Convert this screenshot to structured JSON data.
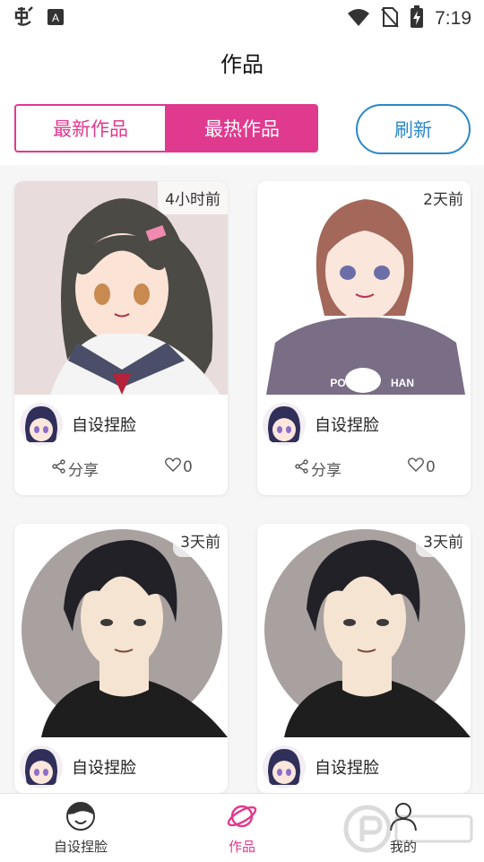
{
  "status_bar": {
    "time": "7:19",
    "left_icons": [
      "bug-app-icon",
      "a-notification-icon"
    ],
    "right_icons": [
      "wifi-icon",
      "no-sim-icon",
      "battery-charging-icon"
    ]
  },
  "header": {
    "title": "作品"
  },
  "tabs": {
    "latest": "最新作品",
    "hot": "最热作品",
    "active": "最热作品"
  },
  "refresh_label": "刷新",
  "cards": [
    {
      "time_ago": "4小时前",
      "author": "自设捏脸",
      "share_label": "分享",
      "likes": "0"
    },
    {
      "time_ago": "2天前",
      "author": "自设捏脸",
      "share_label": "分享",
      "likes": "0",
      "shirt_text_left": "PO",
      "shirt_text_right": "HAN"
    },
    {
      "time_ago": "3天前",
      "author": "自设捏脸"
    },
    {
      "time_ago": "3天前",
      "author": "自设捏脸"
    }
  ],
  "bottom_nav": [
    {
      "label": "自设捏脸",
      "icon": "face-icon",
      "active": false
    },
    {
      "label": "作品",
      "icon": "planet-icon",
      "active": true
    },
    {
      "label": "我的",
      "icon": "person-icon",
      "active": false
    }
  ],
  "colors": {
    "accent": "#e03a8e",
    "refresh": "#2b88c8",
    "background": "#f6f6f6"
  }
}
